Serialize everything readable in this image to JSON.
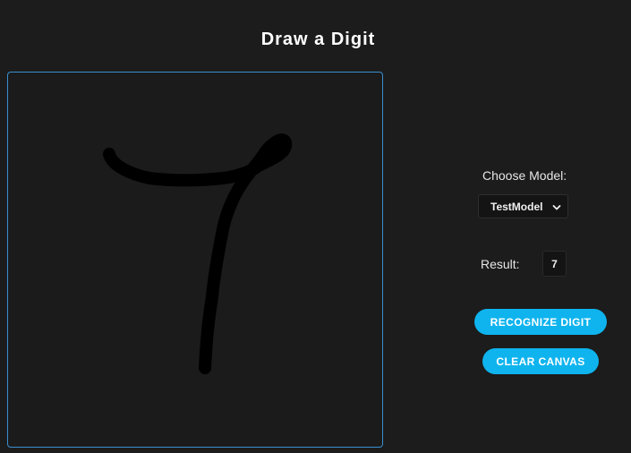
{
  "app": {
    "title": "Draw a Digit"
  },
  "canvas": {
    "background": "#1b1b1b",
    "border_color": "#3a8fd0",
    "stroke_color": "#000000"
  },
  "controls": {
    "choose_model_label": "Choose Model:",
    "model_selected": "TestModel",
    "result_label": "Result:",
    "result_value": "7",
    "recognize_label": "RECOGNIZE DIGIT",
    "clear_label": "CLEAR CANVAS",
    "accent_color": "#0fb4ee"
  },
  "icons": {
    "select_arrow": "chevron-down-icon"
  }
}
